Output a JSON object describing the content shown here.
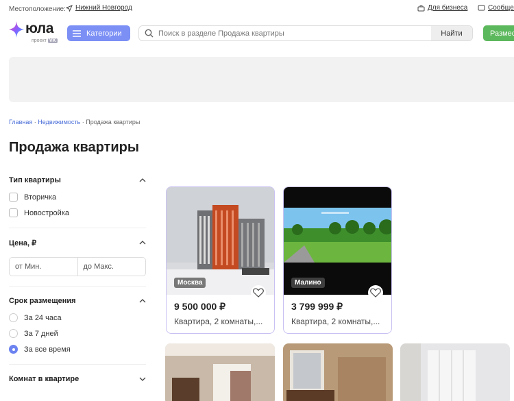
{
  "topbar": {
    "location_label": "Местоположение:",
    "location_value": "Нижний Новгород",
    "business_link": "Для бизнеса",
    "messages_link": "Сообщения"
  },
  "logo": {
    "word": "юла",
    "sub": "проект",
    "sub_badge": "VK"
  },
  "header": {
    "categories_label": "Категории",
    "search_placeholder": "Поиск в разделе Продажа квартиры",
    "search_button": "Найти",
    "post_button": "Разместить"
  },
  "breadcrumbs": {
    "home": "Главная",
    "sep": "·",
    "realty": "Недвижимость",
    "current": "Продажа квартиры"
  },
  "page_title": "Продажа квартиры",
  "filters": {
    "type": {
      "title": "Тип квартиры",
      "options": [
        "Вторичка",
        "Новостройка"
      ]
    },
    "price": {
      "title": "Цена, ₽",
      "from_placeholder": "от Мин.",
      "to_placeholder": "до Макс."
    },
    "period": {
      "title": "Срок размещения",
      "options": [
        "За 24 часа",
        "За 7 дней",
        "За все время"
      ],
      "selected": "За все время"
    },
    "rooms": {
      "title": "Комнат в квартире"
    }
  },
  "listings": [
    {
      "city": "Москва",
      "price": "9 500 000 ₽",
      "title": "Квартира, 2 комнаты,..."
    },
    {
      "city": "Малино",
      "price": "3 799 999 ₽",
      "title": "Квартира, 2 комнаты,..."
    }
  ],
  "colors": {
    "accent": "#7b8ff5",
    "post": "#5cb85c",
    "card_border": "#c9c1f2"
  }
}
